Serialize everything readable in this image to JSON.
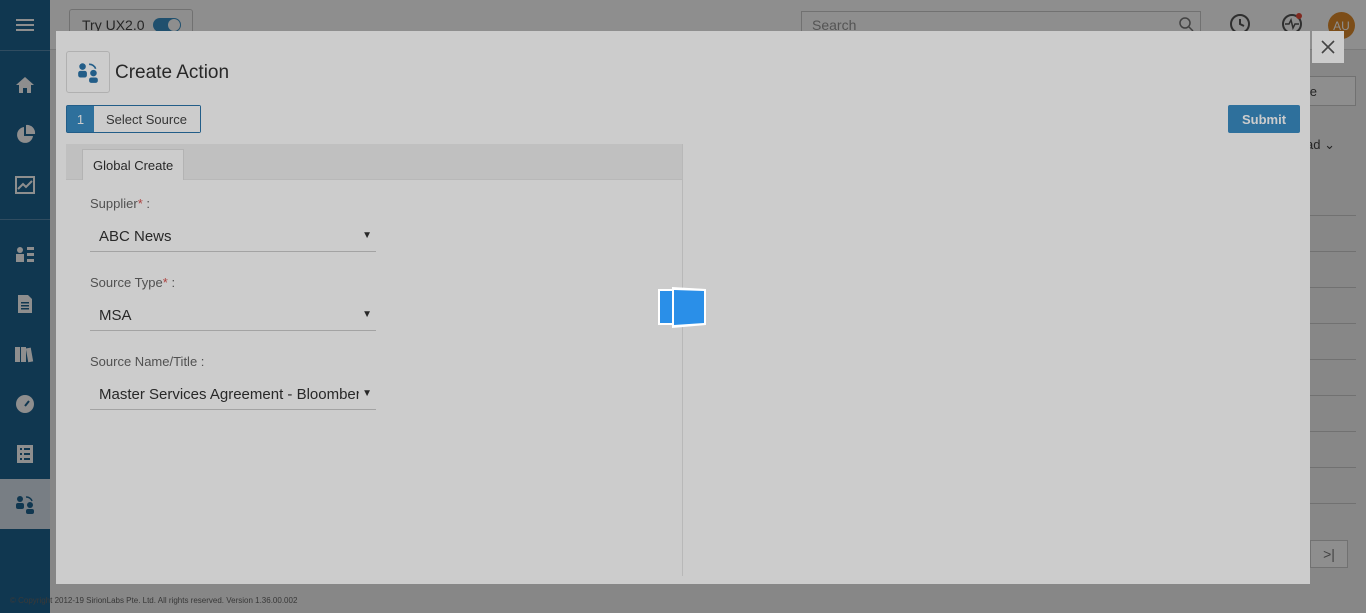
{
  "topbar": {
    "toggle_label": "Try UX2.0",
    "search_placeholder": "Search",
    "avatar_initials": "AU"
  },
  "background": {
    "partial_button_label": "ate",
    "partial_dropdown_label": "ad"
  },
  "footer": {
    "copyright": "© Copyright 2012-19 SirionLabs Pte. Ltd. All rights reserved. Version 1.36.00.002"
  },
  "modal": {
    "title": "Create Action",
    "step": {
      "number": "1",
      "label": "Select Source"
    },
    "submit_label": "Submit",
    "tab_label": "Global Create",
    "fields": [
      {
        "label": "Supplier",
        "required": true,
        "suffix": " :",
        "value": "ABC News"
      },
      {
        "label": "Source Type",
        "required": true,
        "suffix": " :",
        "value": "MSA"
      },
      {
        "label": "Source Name/Title",
        "required": false,
        "suffix": " :",
        "value": "Master Services Agreement - Bloomberg"
      }
    ]
  },
  "colors": {
    "sidebar": "#1f6391",
    "accent": "#3a8cc4",
    "avatar": "#e08c2c",
    "loader": "#2a8fe8"
  },
  "icons": {
    "sidebar": [
      "menu-icon",
      "home-icon",
      "pie-chart-icon",
      "trend-chart-icon",
      "org-chart-icon",
      "document-icon",
      "library-icon",
      "gauge-icon",
      "list-icon",
      "actions-icon"
    ],
    "topbar": [
      "search-icon",
      "history-icon",
      "activity-icon"
    ],
    "modal": [
      "actions-icon",
      "close-icon",
      "loading-spinner-icon"
    ]
  }
}
